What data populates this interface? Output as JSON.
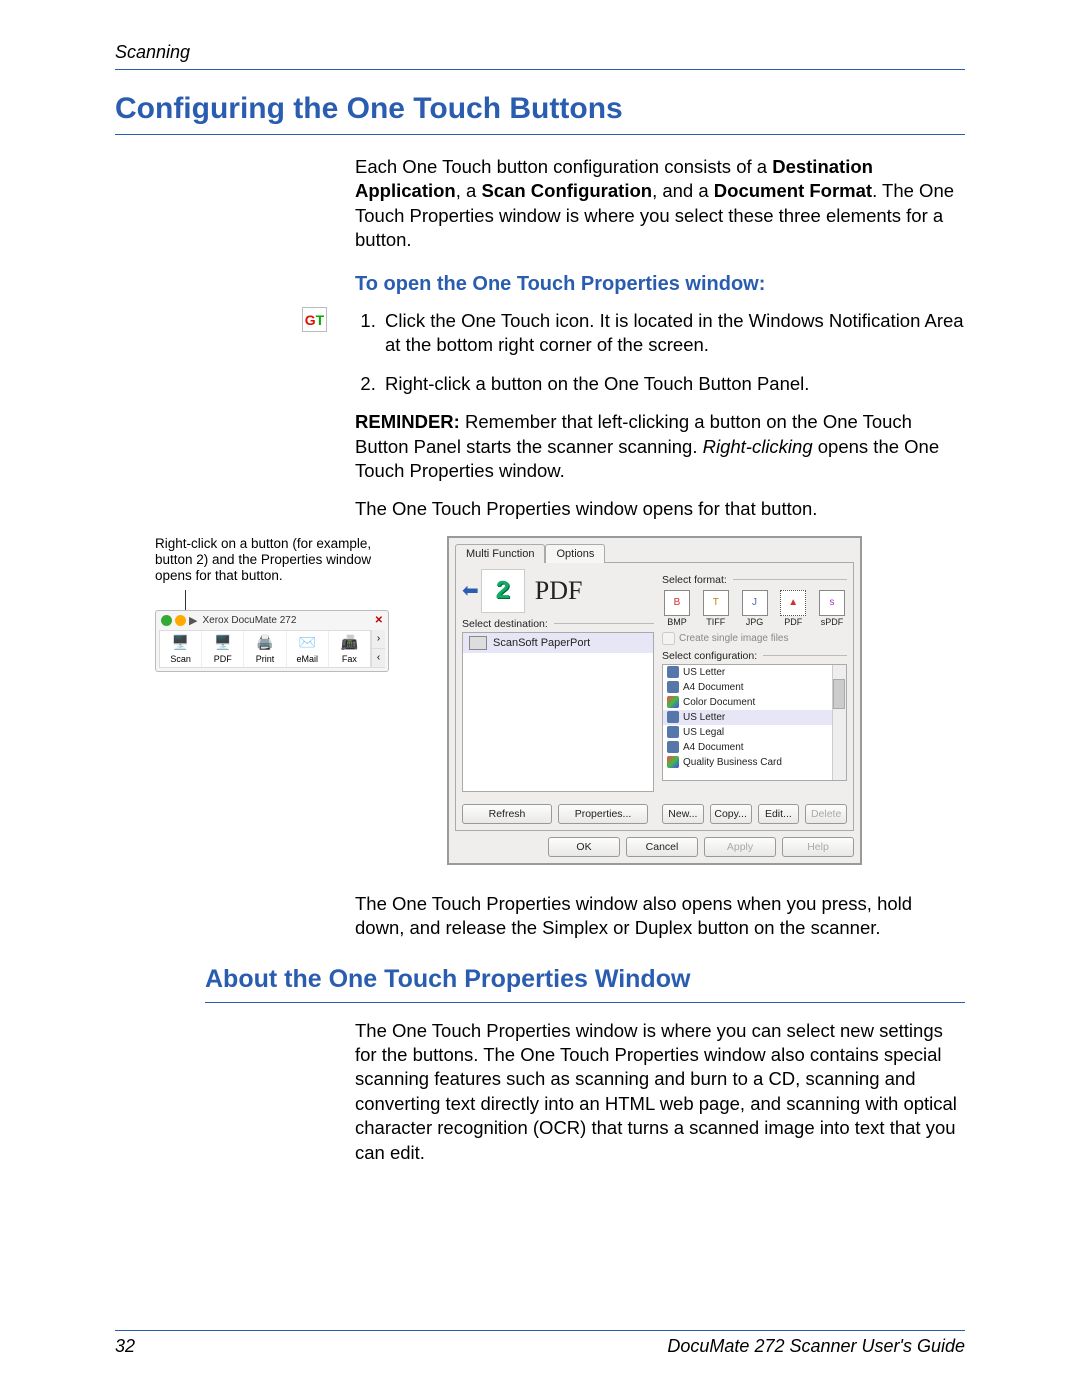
{
  "header": {
    "section": "Scanning"
  },
  "h1": "Configuring the One Touch Buttons",
  "intro": {
    "p1a": "Each One Touch button configuration consists of a ",
    "b1": "Destination Application",
    "p1b": ", a ",
    "b2": "Scan Configuration",
    "p1c": ", and a ",
    "b3": "Document Format",
    "p1d": ". The One Touch Properties window is where you select these three elements for a button."
  },
  "h3_open": "To open the One Touch Properties window:",
  "steps": {
    "s1": "Click the One Touch icon. It is located in the Windows Notification Area at the bottom right corner of the screen.",
    "s2": "Right-click a button on the One Touch Button Panel."
  },
  "reminder": {
    "label": "REMINDER:",
    "text1": "  Remember that left-clicking a button on the One Touch Button Panel starts the scanner scanning. ",
    "italic": "Right-clicking",
    "text2": " opens the One Touch Properties window."
  },
  "afterReminder": "The One Touch Properties window opens for that button.",
  "callout": "Right-click on a button (for example, button 2) and the Properties window opens for that button.",
  "panel": {
    "title": "Xerox DocuMate 272",
    "buttons": [
      "Scan",
      "PDF",
      "Print",
      "eMail",
      "Fax"
    ]
  },
  "props": {
    "tabs": {
      "t1": "Multi Function",
      "t2": "Options"
    },
    "bigLabel": "PDF",
    "destLabel": "Select destination:",
    "destItem": "ScanSoft PaperPort",
    "fmtLabel": "Select format:",
    "formats": [
      "BMP",
      "TIFF",
      "JPG",
      "PDF",
      "sPDF"
    ],
    "chkCreate": "Create single image files",
    "cfgLabel": "Select configuration:",
    "configs": [
      "US Letter",
      "A4 Document",
      "Color Document",
      "US Letter",
      "US Legal",
      "A4 Document",
      "Quality Business Card"
    ],
    "btns1": {
      "refresh": "Refresh",
      "properties": "Properties..."
    },
    "btns2": {
      "new": "New...",
      "copy": "Copy...",
      "edit": "Edit...",
      "del": "Delete"
    },
    "btnsMain": {
      "ok": "OK",
      "cancel": "Cancel",
      "apply": "Apply",
      "help": "Help"
    }
  },
  "afterFig": "The One Touch Properties window also opens when you press, hold down, and release the Simplex or Duplex button on the scanner.",
  "h2": "About the One Touch Properties Window",
  "aboutPara": "The One Touch Properties window is where you can select new settings for the buttons. The One Touch Properties window also contains special scanning features such as scanning and burn to a CD, scanning and converting text directly into an HTML web page, and scanning with optical character recognition (OCR) that turns a scanned image into text that you can edit.",
  "footer": {
    "page": "32",
    "title": "DocuMate 272 Scanner User's Guide"
  }
}
